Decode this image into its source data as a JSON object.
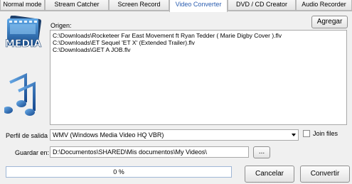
{
  "tabs": [
    {
      "label": "Normal mode",
      "active": false
    },
    {
      "label": "Stream Catcher",
      "active": false
    },
    {
      "label": "Screen Record",
      "active": false
    },
    {
      "label": "Video Converter",
      "active": true
    },
    {
      "label": "DVD / CD Creator",
      "active": false
    },
    {
      "label": "Audio Recorder",
      "active": false
    }
  ],
  "icons": {
    "media": "media-film-icon",
    "media_text": "MEDIA",
    "notes": "music-notes-icon"
  },
  "colors": {
    "active_tab_text": "#2a5db0",
    "media_blue": "#2b6fb5",
    "notes_blue": "#1f5fae"
  },
  "source": {
    "add_button": "Agregar",
    "label": "Origen:",
    "files": [
      "C:\\Downloads\\Rocketeer   Far East Movement ft Ryan Tedder ( Marie Digby Cover ).flv",
      "C:\\Downloads\\ET Sequel 'ET X' (Extended Trailer).flv",
      "C:\\Downloads\\GET A JOB.flv"
    ]
  },
  "output_profile": {
    "label": "Perfil de salida",
    "selected": "WMV (Windows Media Video HQ VBR)",
    "join_files_label": "Join files",
    "join_files_checked": false
  },
  "save_in": {
    "label": "Guardar en:",
    "value": "D:\\Documentos\\SHARED\\Mis documentos\\My Videos\\",
    "browse_label": "..."
  },
  "progress": {
    "text": "0 %",
    "value": 0
  },
  "actions": {
    "cancel_label": "Cancelar",
    "convert_label": "Convertir"
  }
}
